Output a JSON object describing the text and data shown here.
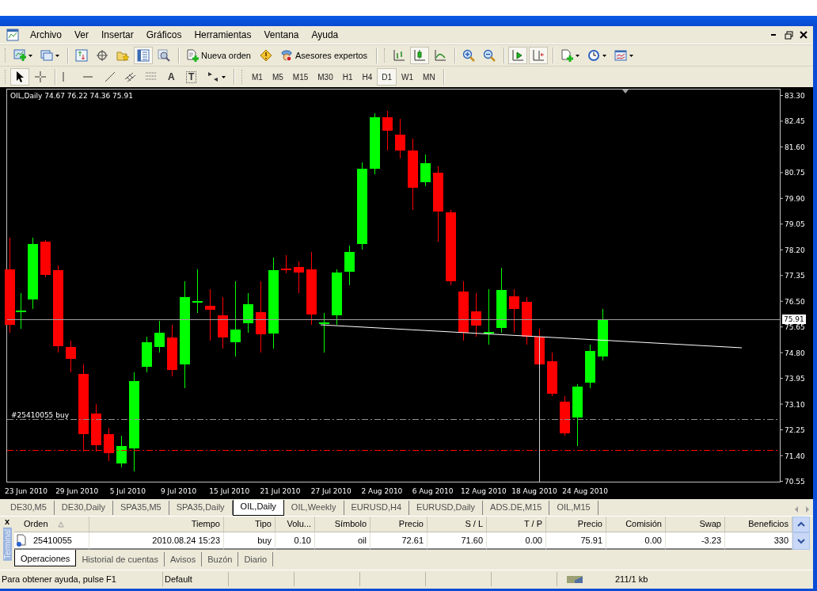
{
  "menu": [
    "Archivo",
    "Ver",
    "Insertar",
    "Gráficos",
    "Herramientas",
    "Ventana",
    "Ayuda"
  ],
  "toolbar_main": [
    {
      "pressed": false
    },
    {
      "pressed": false
    },
    {
      "pressed": false
    },
    {
      "pressed": false
    },
    {
      "pressed": false
    },
    {
      "pressed": true
    },
    {
      "pressed": false
    },
    {
      "pressed": false,
      "label": "Nueva orden"
    },
    {
      "pressed": false
    },
    {
      "pressed": false,
      "label": "Asesores expertos"
    },
    {
      "pressed": false
    },
    {
      "pressed": true
    },
    {
      "pressed": false
    },
    {
      "pressed": false
    },
    {
      "pressed": false
    },
    {
      "pressed": true
    },
    {
      "pressed": true
    },
    {
      "pressed": false
    },
    {
      "pressed": false
    },
    {
      "pressed": false
    }
  ],
  "toolbar_tools": [
    {
      "pressed": true
    },
    {
      "pressed": false
    },
    {
      "pressed": false
    },
    {
      "pressed": false
    },
    {
      "pressed": false
    },
    {
      "pressed": false
    },
    {
      "pressed": false
    },
    {
      "pressed": false,
      "label": "A"
    },
    {
      "pressed": false,
      "label": "T"
    },
    {
      "pressed": false
    }
  ],
  "timeframes": [
    {
      "label": "M1",
      "selected": false
    },
    {
      "label": "M5",
      "selected": false
    },
    {
      "label": "M15",
      "selected": false
    },
    {
      "label": "M30",
      "selected": false
    },
    {
      "label": "H1",
      "selected": false
    },
    {
      "label": "H4",
      "selected": false
    },
    {
      "label": "D1",
      "selected": true
    },
    {
      "label": "W1",
      "selected": false
    },
    {
      "label": "MN",
      "selected": false
    }
  ],
  "chart": {
    "info": "OIL,Daily  74.67 76.22 74.36 75.91",
    "order_label": "#25410055 buy",
    "current_price": "75.91",
    "price_labels": [
      "83.30",
      "82.45",
      "81.60",
      "80.75",
      "79.90",
      "79.05",
      "78.20",
      "77.35",
      "76.50",
      "75.65",
      "74.80",
      "73.95",
      "73.10",
      "72.25",
      "71.40",
      "70.55"
    ],
    "date_labels": [
      "23 Jun 2010",
      "29 Jun 2010",
      "5 Jul 2010",
      "9 Jul 2010",
      "15 Jul 2010",
      "21 Jul 2010",
      "27 Jul 2010",
      "2 Aug 2010",
      "6 Aug 2010",
      "12 Aug 2010",
      "18 Aug 2010",
      "24 Aug 2010"
    ]
  },
  "chart_tabs": [
    {
      "label": "DE30,M5",
      "selected": false
    },
    {
      "label": "DE30,Daily",
      "selected": false
    },
    {
      "label": "SPA35,M5",
      "selected": false
    },
    {
      "label": "SPA35,Daily",
      "selected": false
    },
    {
      "label": "OIL,Daily",
      "selected": true
    },
    {
      "label": "OIL,Weekly",
      "selected": false
    },
    {
      "label": "EURUSD,H4",
      "selected": false
    },
    {
      "label": "EURUSD,Daily",
      "selected": false
    },
    {
      "label": "ADS.DE,M15",
      "selected": false
    },
    {
      "label": "OIL,M15",
      "selected": false
    }
  ],
  "terminal": {
    "side_label": "Terminal",
    "close": "x",
    "columns": [
      "Orden",
      "Tiempo",
      "Tipo",
      "Volu...",
      "Símbolo",
      "Precio",
      "S / L",
      "T / P",
      "Precio",
      "Comisión",
      "Swap",
      "Beneficios"
    ],
    "rows": [
      {
        "cells": [
          "25410055",
          "2010.08.24 15:23",
          "buy",
          "0.10",
          "oil",
          "72.61",
          "71.60",
          "0.00",
          "75.91",
          "0.00",
          "-3.23",
          "330"
        ]
      }
    ],
    "tabs": [
      {
        "label": "Operaciones",
        "selected": true
      },
      {
        "label": "Historial de cuentas",
        "selected": false
      },
      {
        "label": "Avisos",
        "selected": false
      },
      {
        "label": "Buzón",
        "selected": false
      },
      {
        "label": "Diario",
        "selected": false
      }
    ]
  },
  "status_bar": {
    "help": "Para obtener ayuda, pulse F1",
    "profile": "Default",
    "traffic": "211/1 kb"
  }
}
